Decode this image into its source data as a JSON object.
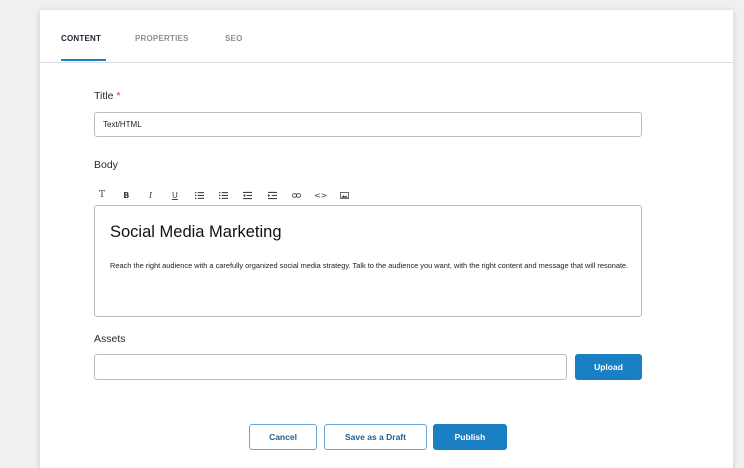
{
  "tabs": [
    {
      "label": "CONTENT",
      "active": true
    },
    {
      "label": "PROPERTIES",
      "active": false
    },
    {
      "label": "SEO",
      "active": false
    }
  ],
  "form": {
    "title_label": "Title",
    "required_mark": "*",
    "title_value": "Text/HTML",
    "body_label": "Body",
    "assets_label": "Assets",
    "assets_value": ""
  },
  "toolbar": {
    "items": [
      "text-style",
      "bold",
      "italic",
      "underline",
      "ordered-list",
      "unordered-list",
      "align",
      "indent",
      "link",
      "code",
      "image"
    ],
    "text_style": "T",
    "bold": "B",
    "italic": "I",
    "underline": "U",
    "code": "<>"
  },
  "editor": {
    "heading": "Social Media Marketing",
    "body": "Reach the right audience with a carefully organized social media strategy.  Talk to the audience you want, with the right content and message that will resonate."
  },
  "buttons": {
    "upload": "Upload",
    "cancel": "Cancel",
    "save_draft": "Save as a Draft",
    "publish": "Publish"
  },
  "colors": {
    "accent": "#1b7fc4",
    "required": "#d9342b",
    "background": "#eef0f2"
  }
}
